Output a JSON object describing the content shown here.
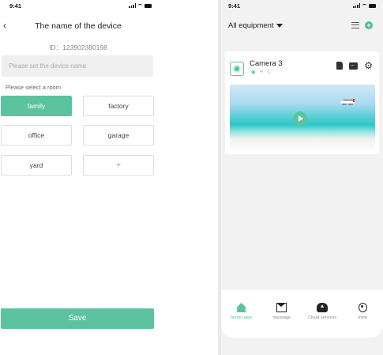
{
  "left": {
    "status_time": "9:41",
    "title": "The name of the device",
    "device_id": "ID：123902380198",
    "name_placeholder": "Please set the device name",
    "room_label": "Please select a room",
    "rooms": [
      {
        "label": "family",
        "selected": true
      },
      {
        "label": "factory",
        "selected": false
      },
      {
        "label": "office",
        "selected": false
      },
      {
        "label": "garage",
        "selected": false
      },
      {
        "label": "yard",
        "selected": false
      }
    ],
    "add_room_symbol": "+",
    "save_label": "Save"
  },
  "right": {
    "status_time": "9:41",
    "equipment_filter": "All equipment",
    "camera": {
      "name": "Camera 3"
    },
    "nav": [
      {
        "label": "home page",
        "icon": "home-icon",
        "active": true
      },
      {
        "label": "message",
        "icon": "mail-icon",
        "active": false
      },
      {
        "label": "Cloud services",
        "icon": "cloud-upload-icon",
        "active": false
      },
      {
        "label": "mine",
        "icon": "user-icon",
        "active": false
      }
    ]
  },
  "colors": {
    "accent": "#5cc39f",
    "plus_button": "#4fbf8f"
  }
}
